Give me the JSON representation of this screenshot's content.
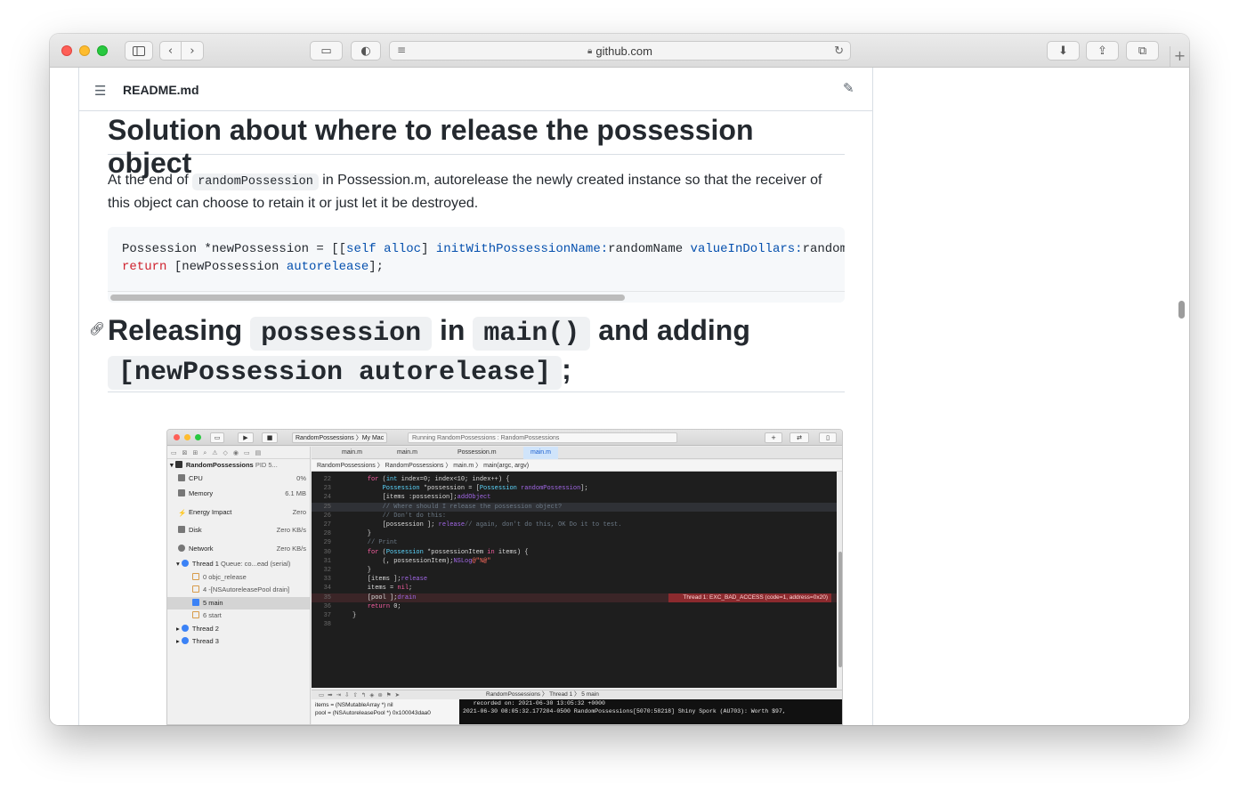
{
  "browser": {
    "address": "github.com",
    "icons": {
      "sidebar": "sidebar-icon",
      "back": "‹",
      "forward": "›",
      "tab_icon": "▭",
      "shield": "◐",
      "reader": "≡",
      "reload": "↻",
      "download": "⬇",
      "share": "⇪",
      "tabs": "⧉",
      "new_tab": "+"
    }
  },
  "file": {
    "name": "README.md"
  },
  "readme": {
    "heading1": "Solution about where to release the possession object",
    "para_before": "At the end of",
    "para_code": "randomPossession",
    "para_after": "in Possession.m, autorelease the newly created instance so that the receiver of this object can choose to retain it or just let it be destroyed.",
    "code": {
      "l1_a": "Possession *newPossession = [[",
      "l1_self": "self",
      "l1_sp": " ",
      "l1_alloc": "alloc",
      "l1_b": "] ",
      "l1_init": "initWithPossessionName:",
      "l1_c": "randomName ",
      "l1_val": "valueInDollars:",
      "l1_d": "random",
      "l2_return": "return",
      "l2_a": " [newPossession ",
      "l2_auto": "autorelease",
      "l2_b": "];"
    },
    "heading2": {
      "w1": "Releasing",
      "c1": "possession",
      "w2": "in",
      "c2": "main()",
      "w3": "and adding",
      "c3": "[newPossession autorelease]",
      "w4": ";"
    }
  },
  "xcode": {
    "scheme": "RandomPossessions 〉My Mac",
    "status": "Running RandomPossessions : RandomPossessions",
    "tabs": [
      "main.m",
      "main.m",
      "Possession.m",
      "main.m"
    ],
    "jumpbar": "RandomPossessions 〉 RandomPossessions 〉 main.m 〉 main(argc, argv)",
    "process": "RandomPossessions",
    "process_pid": "PID 5...",
    "gauges": [
      {
        "label": "CPU",
        "value": "0%"
      },
      {
        "label": "Memory",
        "value": "6.1 MB"
      },
      {
        "label": "Energy Impact",
        "value": "Zero"
      },
      {
        "label": "Disk",
        "value": "Zero KB/s"
      },
      {
        "label": "Network",
        "value": "Zero KB/s"
      }
    ],
    "thread1": "Thread 1",
    "thread1_queue": "Queue: co...ead (serial)",
    "frames": [
      "0 objc_release",
      "4 -[NSAutoreleasePool drain]",
      "5 main",
      "6 start"
    ],
    "thread2": "Thread 2",
    "thread3": "Thread 3",
    "code_lines": [
      {
        "n": "22",
        "a": "    ",
        "k": "for",
        "b": " (",
        "t": "int",
        "c": " index=0; index<10; index++) {"
      },
      {
        "n": "23",
        "a": "        ",
        "t": "Possession",
        "c": " *possession = [",
        "t2": "Possession",
        "m": " randomPossession",
        "d": "];"
      },
      {
        "n": "24",
        "a": "        [items ",
        "m": "addObject",
        "c": ":possession];"
      },
      {
        "n": "25",
        "cm": "        // Where should I release the possession object?"
      },
      {
        "n": "26",
        "cm": "        // Don't do this:"
      },
      {
        "n": "27",
        "a": "        [possession ",
        "m": "release",
        "c": "]; ",
        "cm2": "// again, don't do this, OK Do it to test."
      },
      {
        "n": "28",
        "a": "    }"
      },
      {
        "n": "29",
        "cm": "    // Print"
      },
      {
        "n": "30",
        "a": "    ",
        "k": "for",
        "b": " (",
        "t": "Possession",
        "c": " *possessionItem ",
        "k2": "in",
        "d": " items) {"
      },
      {
        "n": "31",
        "a": "        ",
        "m": "NSLog",
        "b": "(",
        "s": "@\"%@\"",
        "c": ", possessionItem);"
      },
      {
        "n": "32",
        "a": "    }"
      },
      {
        "n": "33",
        "a": "    [items ",
        "m": "release",
        "c": "];"
      },
      {
        "n": "34",
        "a": "    items = ",
        "k": "nil",
        "c": ";"
      },
      {
        "n": "35",
        "a": "    [pool ",
        "m": "drain",
        "c": "];"
      },
      {
        "n": "36",
        "a": "    ",
        "k": "return",
        "c": " 0;"
      },
      {
        "n": "37",
        "a": "}"
      },
      {
        "n": "38",
        "a": ""
      }
    ],
    "error": "Thread 1: EXC_BAD_ACCESS (code=1, address=0x20)",
    "debug_path": "RandomPossessions 〉 Thread 1 〉 5 main",
    "var1": "items = (NSMutableArray *) nil",
    "var2": "pool = (NSAutoreleasePool *) 0x100043daa0",
    "console1": "   recorded on: 2021-06-30 13:05:32 +0000",
    "console2": "2021-06-30 08:05:32.177204-0500 RandomPossessions[5070:58218] Shiny Spork (AU703): Worth $97,"
  }
}
